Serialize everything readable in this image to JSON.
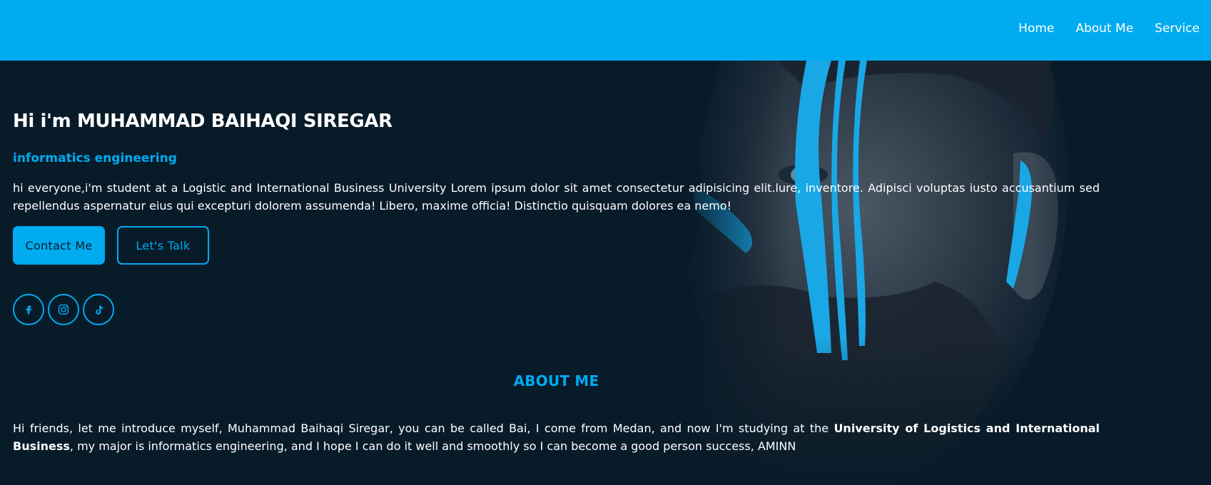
{
  "nav": {
    "items": [
      {
        "label": "Home"
      },
      {
        "label": "About Me"
      },
      {
        "label": "Service"
      }
    ]
  },
  "hero": {
    "title": "Hi i'm MUHAMMAD BAIHAQI SIREGAR",
    "subtitle": "informatics engineering",
    "description": "hi everyone,i'm student at a Logistic and International Business University Lorem ipsum dolor sit amet consectetur adipisicing elit.lure, inventore. Adipisci voluptas iusto accusantium sed repellendus aspernatur eius qui excepturi dolorem assumenda! Libero, maxime officia! Distinctio quisquam dolores ea nemo!",
    "contact_label": "Contact Me",
    "talk_label": "Let's Talk",
    "socials": [
      {
        "icon": "facebook-icon"
      },
      {
        "icon": "instagram-icon"
      },
      {
        "icon": "tiktok-icon"
      }
    ]
  },
  "about": {
    "heading": "ABOUT ME",
    "text_before": "Hi friends, let me introduce myself, Muhammad Baihaqi Siregar, you can be called Bai, I come from Medan, and now I'm studying at the ",
    "text_bold": "University of Logistics and International Business",
    "text_after": ", my major is informatics engineering, and I hope I can do it well and smoothly so I can become a good person success, AMINN"
  },
  "colors": {
    "accent": "#00abf0",
    "background": "#081b29",
    "text": "#ffffff"
  }
}
